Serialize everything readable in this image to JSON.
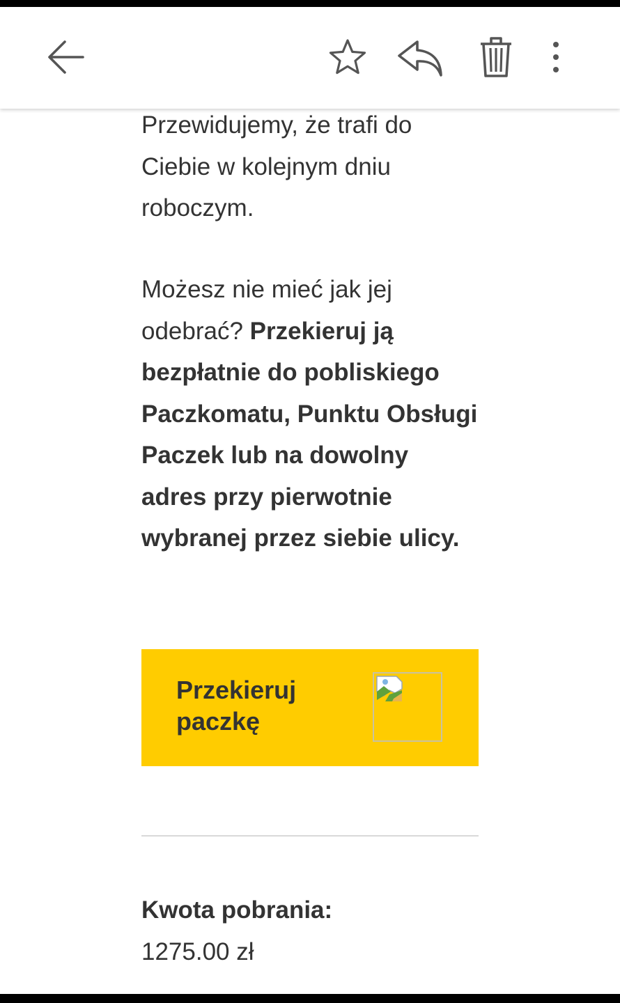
{
  "toolbar": {
    "back_icon": "arrow-left-icon",
    "star_icon": "star-outline-icon",
    "reply_icon": "reply-icon",
    "trash_icon": "trash-icon",
    "more_icon": "more-vertical-icon"
  },
  "email": {
    "paragraph1": "Przewidujemy, że trafi do Ciebie w kolejnym dniu roboczym.",
    "paragraph2_lead": "Możesz nie mieć jak jej odebrać? ",
    "paragraph2_bold": "Przekieruj ją bezpłatnie do pobliskiego Paczkomatu, Punktu Obsługi Paczek lub na dowolny adres przy pierwotnie wybranej przez siebie ulicy.",
    "cta_label": "Przekieruj paczkę",
    "cta_image_icon": "broken-image-icon",
    "amount_label": "Kwota pobrania:",
    "amount_value": "1275.00 zł"
  },
  "colors": {
    "accent_yellow": "#ffcc00",
    "text": "#333333",
    "icon": "#555555"
  }
}
